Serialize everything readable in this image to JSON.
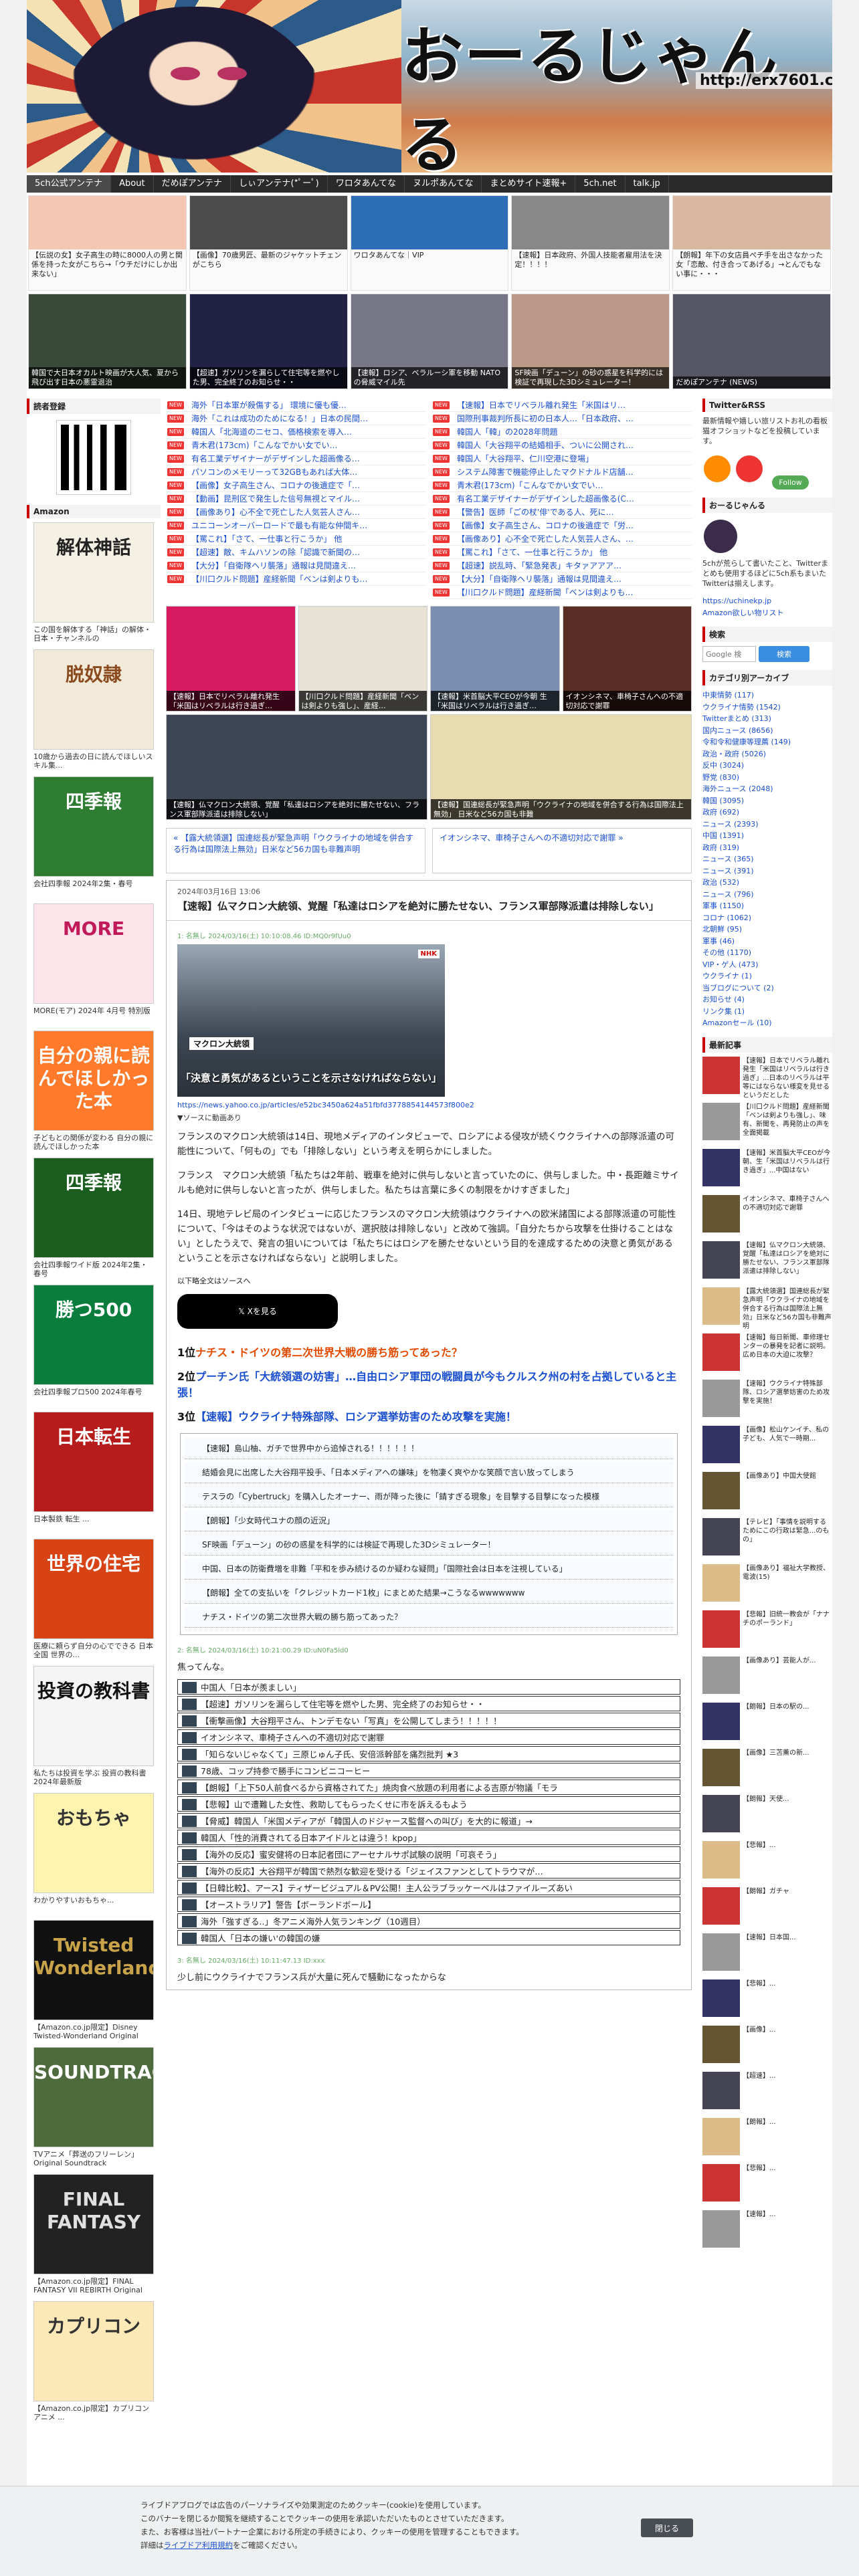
{
  "header": {
    "title": "おーるじゃんる",
    "url": "http://erx7601.com"
  },
  "nav": [
    "5ch公式アンテナ",
    "About",
    "だめぽアンテナ",
    "しぃアンテナ(*ﾟーﾟ)",
    "ワロタあんてな",
    "ヌルポあんてな",
    "まとめサイト速報+",
    "5ch.net",
    "talk.jp"
  ],
  "thumbs": [
    {
      "cap": "【伝説の女】女子高生の時に8000人の男と関係を持った女がこちら→「ウチだけにしか出来ない」",
      "dark": false,
      "color": "#f6c6b5"
    },
    {
      "cap": "【画像】70歳男匠、最新のジャケットチェンがこちら",
      "dark": false,
      "color": "#4b4b4b"
    },
    {
      "cap": "ワロタあんてな｜VIP",
      "dark": false,
      "color": "#2c6fb7"
    },
    {
      "cap": "【速報】日本政府、外国人技能者雇用法を決定！！！！",
      "dark": false,
      "color": "#888"
    },
    {
      "cap": "【朗報】年下の女店員ぺチ手を出さなかった女「恋敵、付き合ってあげる」→とんでもない事に・・・",
      "dark": false,
      "color": "#dab7a0"
    },
    {
      "cap": "韓国で大日本オカルト映画が大人気、夏から飛び出す日本の悪霊退治",
      "dark": true,
      "color": "#3a4a3a"
    },
    {
      "cap": "【超速】ガソリンを漏らして住宅等を燃やした男、完全終了のお知らせ・・",
      "dark": true,
      "color": "#224"
    },
    {
      "cap": "【速報】ロシア、ベラルーシ軍を移動 NATOの脅威マイル先",
      "dark": true,
      "color": "#778"
    },
    {
      "cap": "SF映画「デューン」の砂の惑星を科学的には検証で再現した3Dシミュレーター！",
      "dark": true,
      "color": "#b98"
    },
    {
      "cap": "だめぽアンテナ (NEWS)",
      "dark": true,
      "color": "#556"
    }
  ],
  "left": {
    "reader_label": "読者登録",
    "amazon_label": "Amazon",
    "books": [
      {
        "title": "解体神話",
        "cap": "この国を解体する「神話」の解体・日本・チャンネルの",
        "bg": "#f4f0e4",
        "fg": "#222"
      },
      {
        "title": "脱奴隷",
        "cap": "10歳から過去の日に読んでほしいスキル集...",
        "bg": "#f1ead8",
        "fg": "#8a4a1e"
      },
      {
        "title": "四季報",
        "cap": "会社四季報 2024年2集・春号",
        "bg": "#2e7d32",
        "fg": "#fff"
      },
      {
        "title": "MORE",
        "cap": "MORE(モア) 2024年 4月号 特別版",
        "bg": "#fde4ea",
        "fg": "#c01a5a"
      },
      {
        "title": "自分の親に読んでほしかった本",
        "cap": "子どもとの関係が変わる 自分の親に読んでほしかった本",
        "bg": "#ff7a2a",
        "fg": "#fff"
      },
      {
        "title": "四季報",
        "cap": "会社四季報ワイド版 2024年2集・春号",
        "bg": "#1b5e20",
        "fg": "#fff"
      },
      {
        "title": "勝つ500",
        "cap": "会社四季報プロ500 2024年春号",
        "bg": "#0a7c3c",
        "fg": "#fff"
      },
      {
        "title": "日本転生",
        "cap": "日本製鉄 転生 ...",
        "bg": "#b71c1c",
        "fg": "#fff"
      },
      {
        "title": "世界の住宅",
        "cap": "医療に頼らず自分の心でできる 日本全国 世界の...",
        "bg": "#d84315",
        "fg": "#fff"
      },
      {
        "title": "投資の教科書",
        "cap": "私たちは投資を学ぶ 投資の教科書 2024年最新版",
        "bg": "#f5f5f5",
        "fg": "#111"
      },
      {
        "title": "おもちゃ",
        "cap": "わかりやすいおもちゃ...",
        "bg": "#fff3b0",
        "fg": "#333"
      },
      {
        "title": "Twisted Wonderland",
        "cap": "【Amazon.co.jp限定】Disney Twisted-Wonderland Original",
        "bg": "#111",
        "fg": "#c9a34a"
      },
      {
        "title": "SOUNDTRACK",
        "cap": "TVアニメ「葬送のフリーレン」Original Soundtrack",
        "bg": "#4d6b3c",
        "fg": "#fff"
      },
      {
        "title": "FINAL FANTASY",
        "cap": "【Amazon.co.jp限定】FINAL FANTASY VII REBIRTH Original",
        "bg": "#222",
        "fg": "#e0e0e0"
      },
      {
        "title": "カプリコン",
        "cap": "【Amazon.co.jp限定】カプリコン アニメ ... ",
        "bg": "#fde9b8",
        "fg": "#333"
      }
    ]
  },
  "rank_left": [
    "海外「日本軍が殺傷する」 環境に優も優…",
    "海外「これは成功のためになる！」日本の民間…",
    "韓国人「北海道のニセコ、価格検索を導入…",
    "青木君(173cm)「こんなでかい女でい…",
    "有名工業デザイナーがデザインした超画像る…",
    "パソコンのメモリーって32GBもあれば大体…",
    "【画像】女子高生さん、コロナの後遺症で「…",
    "【動画】昆刑区で発生した信号無視とマイル…",
    "【画像あり】心不全で死亡した人気芸人さん…",
    "ユニコーンオーバーロードで最も有能な仲間キ…",
    "【罵これ】「さて、一仕事と行こうか」 他",
    "【超速】敵、キムハソンの除「認識で新聞の…",
    "【大分】「自衛隊ヘリ襲落」通報は見間違え…",
    "【川口クルド問題】産経新聞「ベンは剣よりも…"
  ],
  "rank_right": [
    "【速報】日本でリベラル離れ発生「米国はリ…",
    "国際刑事裁判所長に初の日本人…「日本政府、…",
    "韓国人「韓」の2028年問題",
    "韓国人「大谷翔平の結婚相手、ついに公開され…",
    "韓国人「大谷翔平、仁川空港に登場」",
    "システム障害で機能停止したマクドナルド店舗…",
    "青木君(173cm)「こんなでかい女でい…",
    "有名工業デザイナーがデザインした超画像る(C…",
    "【警告】医師「ごの杖'俳'である人、死に…",
    "【画像】女子高生さん、コロナの後遺症で「労…",
    "【画像あり】心不全で死亡した人気芸人さん、…",
    "【罵これ】「さて、一仕事と行こうか」 他",
    "【超速】説乱時、「緊急発表」キタァアアア…",
    "【大分】「自衛隊ヘリ襲落」通報は見間違え…",
    "【川口クルド問題】産経新聞「ベンは剣よりも…"
  ],
  "gallery": [
    {
      "cap": "【速報】日本でリベラル離れ発生「米国はリベラルは行き過ぎ…",
      "color": "#d81b60"
    },
    {
      "cap": "【川口クルド問題】産経新聞「ベンは剣よりも強し」、産経…",
      "color": "#e8e2d5"
    },
    {
      "cap": "【速報】米首脳大平CEOが今朝 生「米国はリベラルは行き過ぎ…",
      "color": "#7a8fb0"
    },
    {
      "cap": "イオンシネマ、車椅子さんへの不適切対応で謝罪",
      "color": "#5a2d25"
    },
    {
      "cap": "【速報】仏マクロン大統領、覚醒「私達はロシアを絶対に勝たせない、フランス軍部隊派遣は排除しない」",
      "color": "#3c4654"
    },
    {
      "cap": "【速報】国連総長が緊急声明「ウクライナの地域を併合する行為は国際法上無効」 日米など56カ国も非難",
      "color": "#e9dbb0"
    }
  ],
  "pager": {
    "prev": "« 【露大統領選】国連総長が緊急声明「ウクライナの地域を併合する行為は国際法上無効」日米など56カ国も非難声明",
    "next": "イオンシネマ、車椅子さんへの不適切対応で謝罪 »"
  },
  "article": {
    "date": "2024年03月16日 13:06",
    "title": "【速報】仏マクロン大統領、覚醒「私達はロシアを絶対に勝たせない、フランス軍部隊派遣は排除しない」",
    "post_header": "1: 名無し 2024/03/16(土) 10:10:08.46 ID:MQ0r9fUu0",
    "img_tag": "マクロン大統領",
    "img_caption": "「決意と勇気があるということを示さなければならない」",
    "img_nhk": "NHK",
    "link": "https://news.yahoo.co.jp/articles/e52bc3450a624a51fbfd3778854144573f800e2",
    "video": "▼ソースに動画あり",
    "paras": [
      "フランスのマクロン大統領は14日、現地メディアのインタビューで、ロシアによる侵攻が続くウクライナへの部隊派遣の可能性について、「何もの」でも「排除しない」という考えを明らかにしました。",
      "フランス　マクロン大統領「私たちは2年前、戦車を絶対に供与しないと言っていたのに、供与しました。中・長距離ミサイルも絶対に供与しないと言ったが、供与しました。私たちは言葉に多くの制限をかけすぎました」",
      "14日、現地テレビ局のインタビューに応じたフランスのマクロン大統領はウクライナへの欧米諸国による部隊派遣の可能性について、「今はそのような状況ではないが、選択肢は排除しない」と改めて強調。「自分たちから攻撃を仕掛けることはない」としたうえで、発言の狙いについては「私たちにはロシアを勝たせないという目的を達成するための決意と勇気があるということを示さなければならない」と説明しました。"
    ],
    "more": "以下略全文はソースへ",
    "xbtn": "Xを見る",
    "top3": [
      {
        "n": "1位",
        "t": "ナチス・ドイツの第二次世界大戦の勝ち筋ってあった？"
      },
      {
        "n": "2位",
        "t": "プーチン氏「大統領選の妨害」…自由ロシア軍団の戦闘員が今もクルスク州の村を占拠していると主張！"
      },
      {
        "n": "3位",
        "t": "【速報】ウクライナ特殊部隊、ロシア選挙妨害のため攻撃を実施！"
      }
    ],
    "box": [
      "【速報】島山柚、ガチで世界中から追悼される！！！！！！",
      "結婚会見に出席した大谷翔平投手、「日本メディアへの嫌味」を物凄く爽やかな笑顔で言い放ってしまう",
      "テスラの「Cybertruck」を購入したオーナー、雨が降った後に「錆すぎる現象」を目撃する目撃になった模様",
      "【朗報】「少女時代ユナの顔の近況」",
      "SF映画「デューン」の砂の惑星を科学的には検証で再現した3Dシミュレーター！",
      "中国、日本の防衛費増を非難「平和を歩み続けるのか疑わな疑問」「国際社会は日本を注視している」",
      "【朗報】全ての支払いを「クレジットカード1枚」にまとめた結果→こうなるwwwwwww",
      "ナチス・ドイツの第二次世界大戦の勝ち筋ってあった？"
    ],
    "c2_header": "2: 名無し 2024/03/16(土) 10:21:00.29 ID:uN0Fa5ld0",
    "c2_say": "焦ってんな。",
    "list": [
      "中国人「日本が羨ましい」",
      "【超速】ガソリンを漏らして住宅等を燃やした男、完全終了のお知らせ・・",
      "【衝撃画像】大谷翔平さん、トンデモない「写真」を公開してしまう！！！！！",
      "イオンシネマ、車椅子さんへの不適切対応で謝罪",
      "「知らないじゃなくて」三原じゅん子氏、安倍派幹部を痛烈批判 ★3",
      "78歳、コップ持参で勝手にコンビニコーヒー",
      "【朗報】「上下50人前食べるから資格されてた」焼肉食べ放題の利用者による吉原が物議「モラ",
      "【悲報】山で遭難した女性、救助してもらったくせに市を訴えるもよう",
      "【脅威】韓国人「米国メディアが「韓国人のドジャース監督への叫び」を大的に報道」→",
      "韓国人「性的消費されてる日本アイドルとは違う！kpop」",
      "【海外の反応】蜜安健将の日本記者団にアーセナルサポ試験の説明「可哀そう」",
      "【海外の反応】大谷翔平が韓国で熱烈な歓迎を受ける「ジェイスファンとしてトラウマが…",
      "【日韓比較】、アース】ティザービジュアル＆PV公開！主人公ラブラッケーベルはファイルーズあい",
      "【オーストラリア】警告【ボーランドボール】",
      "海外「強すぎる..」冬アニメ海外人気ランキング（10週目）",
      "韓国人「日本の嫌い'の韓国の嫌"
    ],
    "c3_header": "3: 名無し 2024/03/16(土) 10:11:47.13 ID:xxx",
    "c3_say": "少し前にウクライナでフランス兵が大量に死んで騒動になったからな"
  },
  "right": {
    "twitter_label": "Twitter&RSS",
    "twitter_desc": "最新情報や嬉しい旅リストお礼の看板猫オフショットなどを投稿しています。",
    "follow": "Follow",
    "profile_label": "おーるじゃんる",
    "profile_text": "5chが荒らして書いたこと、Twitterまとめも使用するほどに5ch系もまいたTwitterは揃えします。",
    "profile_link": "https://uchinekp.jp",
    "profile_link2": "Amazon欲しい物リスト",
    "search_label": "検索",
    "search_placeholder": "Google 検",
    "search_btn": "検索",
    "cat_label": "カテゴリ別アーカイブ",
    "cats": [
      "中東情勢 (117)",
      "ウクライナ情勢 (1542)",
      "Twitterまとめ (313)",
      "国内ニュース (8656)",
      "令和令和健康等理薦 (149)",
      "政治・政府 (5026)",
      "反中 (3024)",
      "野党 (830)",
      "海外ニュース (2048)",
      "韓国 (3095)",
      "政府 (692)",
      "ニュース (2393)",
      "中国 (1391)",
      "政府 (319)",
      "ニュース (365)",
      "ニュース (391)",
      "政治 (532)",
      "ニュース (796)",
      "軍事 (1150)",
      "コロナ (1062)",
      "北朝鮮 (95)",
      "軍事 (46)",
      "その他 (1170)",
      "VIP・ゲ人 (473)",
      "ウクライナ (1)",
      "当ブログについて (2)",
      "お知らせ (4)",
      "リンク集 (1)",
      "Amazonセール (10)"
    ],
    "recent_label": "最新記事",
    "recent": [
      "【速報】日本でリベラル離れ発生「米国はリベラルは行き過ぎ」...日本のリベラルは平等にはならない様変を見せるというだとした",
      "【川口クルド問題】産経新聞「ベンは剣よりも強し」、味有、新聞を、再発防止の声を全面掲載",
      "【速報】米首脳大平CEOが今朝、生「米国はリベラルは行き過ぎ」...中国はない",
      "イオンシネマ、車椅子さんへの不適切対応で謝罪",
      "【速報】仏マクロン大統領、覚醒「私達はロシアを絶対に勝たせない、フランス軍部隊派遣は排除しない」",
      "【露大統領選】国連総長が緊急声明「ウクライナの地域を併合する行為は国際法上無効」日米など56カ国も非難声明",
      "【速報】毎日新聞、車修理センターの暴発を記者に説明。広め日本の大迫に攻撃？",
      "【速報】ウクライナ特殊部隊、ロシア選挙妨害のため攻撃を実施！",
      "【画像】松山ケンイチ、私の子ども、人気で一時期...",
      "【画像あり】中国大使館",
      "【テレビ】「事情を説明するためにこの行政は緊急...のもの」",
      "【画像あり】福祉大学教授、電波(15)",
      "【悲報】旧統一教会が「ナナチのポーランド」",
      "【画像あり】芸能人が...",
      "【朗報】日本の駅の...",
      "【画像】三苫薫の新...",
      "【朗報】天使...",
      "【悲報】...",
      "【朗報】ガチャ",
      "【速報】日本国...",
      "【悲報】...",
      "【画像】...",
      "【超速】...",
      "【朗報】...",
      "【悲報】...",
      "【速報】..."
    ]
  },
  "cookie": {
    "l1": "ライブドアブログでは広告のパーソナライズや効果測定のためクッキー(cookie)を使用しています。",
    "l2": "このバナーを閉じるか閲覧を継続することでクッキーの使用を承認いただいたものとさせていただきます。",
    "l3": "また、お客様は当社パートナー企業における所定の手続きにより、クッキーの使用を管理することもできます。",
    "l4": "詳細は",
    "link": "ライブドア利用規約",
    "l5": "をご確認ください。",
    "close": "閉じる"
  }
}
